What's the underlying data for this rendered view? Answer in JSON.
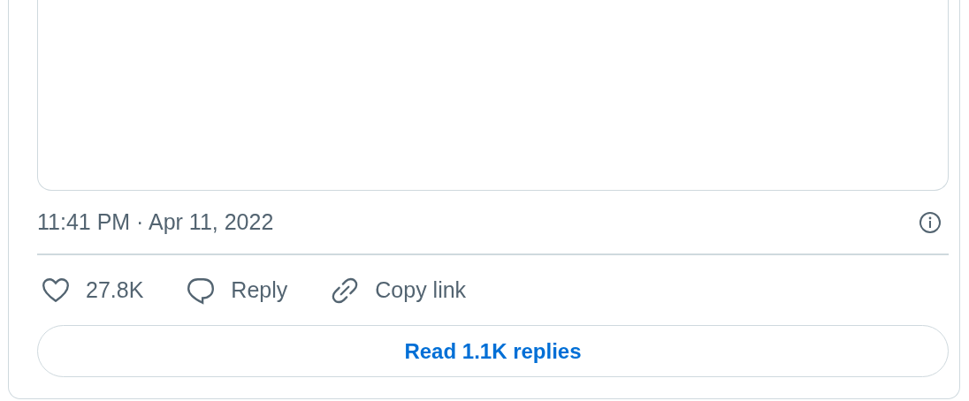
{
  "timestamp": "11:41 PM · Apr 11, 2022",
  "actions": [
    {
      "kind": "like",
      "label": "27.8K"
    },
    {
      "kind": "reply",
      "label": "Reply"
    },
    {
      "kind": "copy",
      "label": "Copy link"
    }
  ],
  "replies_button": "Read 1.1K replies"
}
